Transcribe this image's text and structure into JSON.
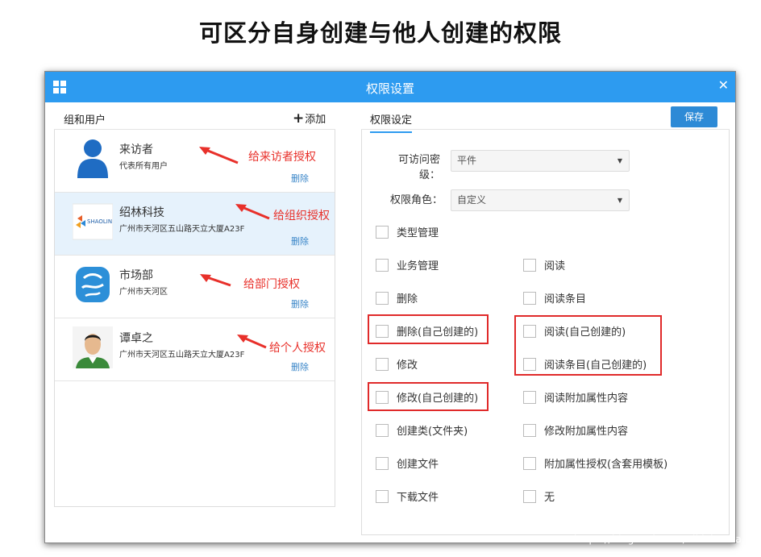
{
  "page_title": "可区分自身创建与他人创建的权限",
  "dialog": {
    "title": "权限设置",
    "close_icon": "close-icon"
  },
  "left": {
    "tab": "组和用户",
    "add_label": "添加",
    "users": [
      {
        "name": "来访者",
        "sub": "代表所有用户",
        "delete": "删除",
        "annotation": "给来访者授权",
        "avatar": "person-icon"
      },
      {
        "name": "绍林科技",
        "sub": "广州市天河区五山路天立大厦A23F",
        "delete": "删除",
        "annotation": "给组织授权",
        "avatar": "company-logo",
        "logo_text": "SHAOLIN"
      },
      {
        "name": "市场部",
        "sub": "广州市天河区",
        "delete": "删除",
        "annotation": "给部门授权",
        "avatar": "department-logo"
      },
      {
        "name": "谭卓之",
        "sub": "广州市天河区五山路天立大厦A23F",
        "delete": "删除",
        "annotation": "给个人授权",
        "avatar": "user-photo"
      }
    ]
  },
  "right": {
    "tab": "权限设定",
    "save": "保存",
    "secret_label_1": "可访问密",
    "secret_label_2": "级：",
    "secret_value": "平件",
    "role_label": "权限角色：",
    "role_value": "自定义",
    "perms_left": [
      "类型管理",
      "业务管理",
      "删除",
      "删除(自己创建的)",
      "修改",
      "修改(自己创建的)",
      "创建类(文件夹)",
      "创建文件",
      "下载文件"
    ],
    "perms_right": [
      "阅读",
      "阅读条目",
      "阅读(自己创建的)",
      "阅读条目(自己创建的)",
      "阅读附加属性内容",
      "修改附加属性内容",
      "附加属性授权(含套用模板)",
      "无"
    ]
  },
  "watermark": "https://blog.csdn.net/vikichacha",
  "colors": {
    "titlebar": "#2d9bf0",
    "save": "#2d8ad6",
    "annotation": "#e8302a",
    "highlight_box": "#e02a2a",
    "selected_row": "#e6f2fc"
  }
}
